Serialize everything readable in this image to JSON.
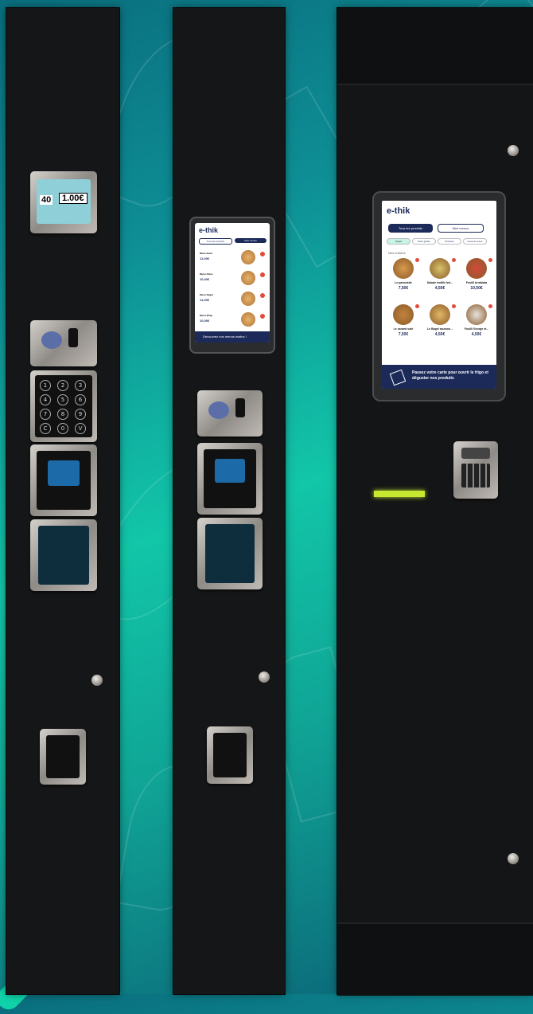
{
  "colors": {
    "accent": "#10d3a9",
    "machine": "#151617",
    "screen_nav": "#1c2a5a"
  },
  "left_machine": {
    "display": {
      "left": "40",
      "right": "1.00€"
    },
    "keypad": [
      "1",
      "2",
      "3",
      "4",
      "5",
      "6",
      "7",
      "8",
      "9",
      "C",
      "0",
      "V"
    ]
  },
  "middle_machine": {
    "screen": {
      "brand": "e-thik",
      "tab_products": "Tous les produits",
      "tab_menus": "Mes menus",
      "items": [
        {
          "name": "Menu Bowl",
          "price": "11,00€"
        },
        {
          "name": "Menu Pates",
          "price": "10,00€"
        },
        {
          "name": "Menu Bagel",
          "price": "11,00€"
        },
        {
          "name": "Menu Wrap",
          "price": "10,00€"
        }
      ],
      "footer": "Découvrez nos menus malins !"
    }
  },
  "right_machine": {
    "screen": {
      "brand": "e-thik",
      "tab_products": "Tous les produits",
      "tab_menus": "Mes menus",
      "filters": [
        "Vegan",
        "Sans gluten",
        "Protéiné",
        "Coup de cœur"
      ],
      "section": "Nos entrées",
      "items": [
        {
          "name": "Le panoustie",
          "price": "7,50€"
        },
        {
          "name": "Salade lentille bet...",
          "price": "4,50€"
        },
        {
          "name": "Fusilli Arrabiata",
          "price": "10,50€"
        },
        {
          "name": "Le canard soté",
          "price": "7,50€"
        },
        {
          "name": "Le Bagel saumon...",
          "price": "4,50€"
        },
        {
          "name": "Fusilli George et...",
          "price": "4,50€"
        }
      ],
      "footer": "Passez votre carte pour ouvrir le frigo et déguster nos produits"
    }
  }
}
